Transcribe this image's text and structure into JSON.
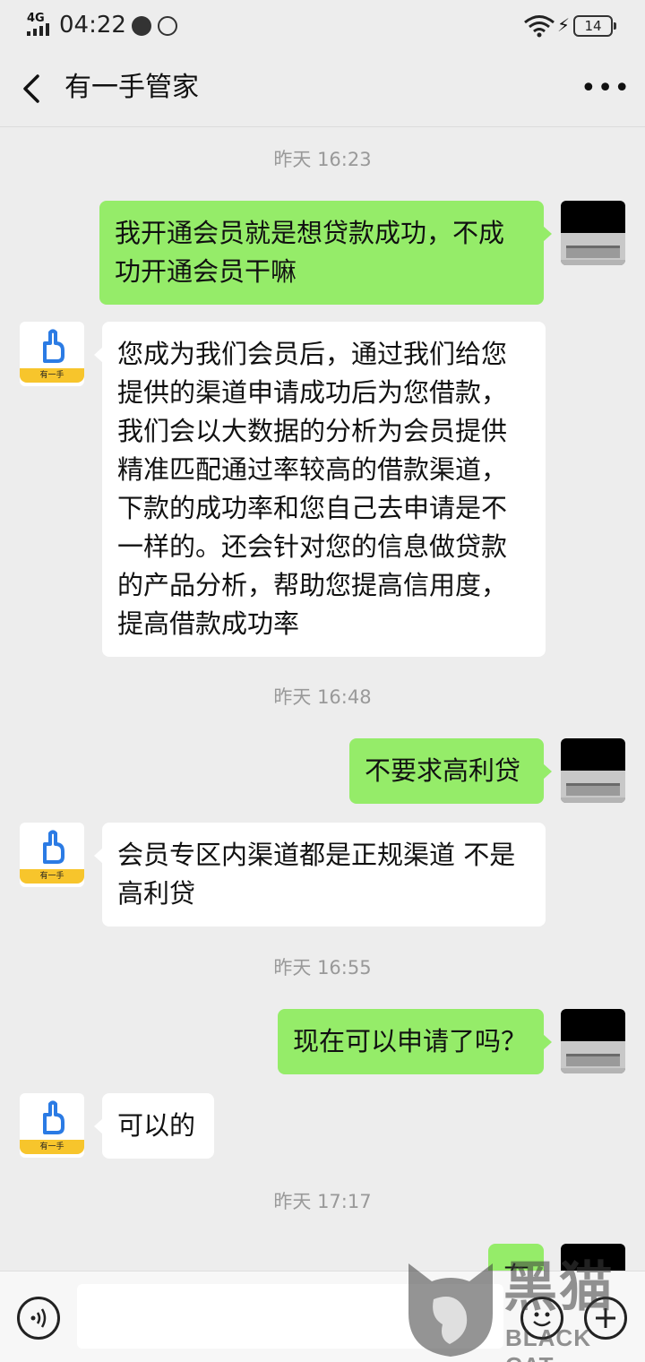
{
  "status_bar": {
    "network": "4G",
    "time": "04:22",
    "battery": "14"
  },
  "header": {
    "title": "有一手管家"
  },
  "bot": {
    "avatar_caption": "有一手"
  },
  "messages": {
    "ts1": "昨天 16:23",
    "m1": "我开通会员就是想贷款成功，不成功开通会员干嘛",
    "m2": "您成为我们会员后，通过我们给您提供的渠道申请成功后为您借款，我们会以大数据的分析为会员提供精准匹配通过率较高的借款渠道，下款的成功率和您自己去申请是不一样的。还会针对您的信息做贷款的产品分析，帮助您提高信用度，提高借款成功率",
    "ts2": "昨天 16:48",
    "m3": "不要求高利贷",
    "m4": "会员专区内渠道都是正规渠道  不是高利贷",
    "ts3": "昨天 16:55",
    "m5": "现在可以申请了吗？",
    "m6": "可以的",
    "ts4": "昨天 17:17",
    "m7": "有"
  },
  "watermark": {
    "text": "黑猫",
    "sub": "BLACK CAT"
  },
  "colors": {
    "outgoing_bubble": "#95ec69",
    "incoming_bubble": "#ffffff",
    "background": "#ededed",
    "bot_accent": "#f7c52c"
  }
}
